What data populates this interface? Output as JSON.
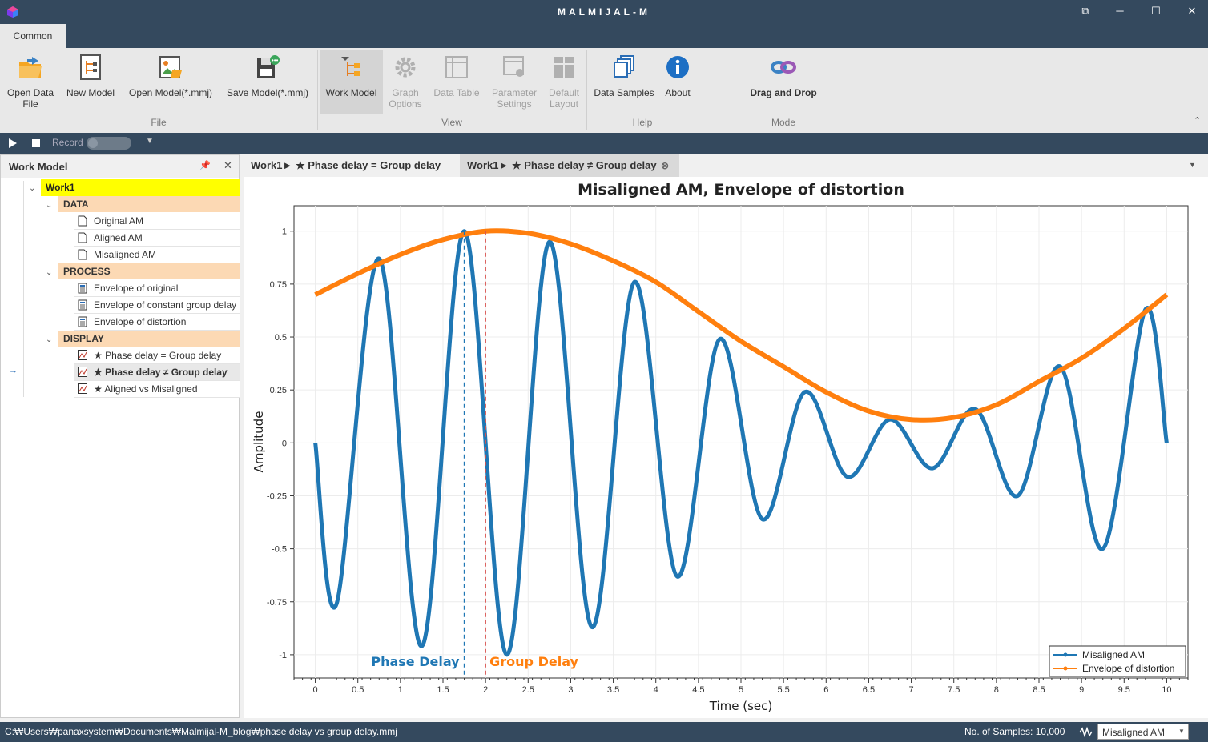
{
  "app": {
    "title": "MALMIJAL-M"
  },
  "ribbon": {
    "tab": "Common",
    "buttons": {
      "open_data_line1": "Open Data",
      "open_data_line2": "File",
      "new_model": "New Model",
      "open_model": "Open Model(*.mmj)",
      "save_model": "Save Model(*.mmj)",
      "work_model": "Work Model",
      "graph_options_line1": "Graph",
      "graph_options_line2": "Options",
      "data_table": "Data Table",
      "param_settings_line1": "Parameter",
      "param_settings_line2": "Settings",
      "default_layout_line1": "Default",
      "default_layout_line2": "Layout",
      "data_samples": "Data Samples",
      "about": "About",
      "drag_drop": "Drag and Drop"
    },
    "groups": {
      "file": "File",
      "view": "View",
      "help": "Help",
      "mode": "Mode"
    }
  },
  "record_bar": {
    "record_label": "Record"
  },
  "work_model_panel": {
    "title": "Work Model",
    "root": "Work1",
    "categories": [
      {
        "name": "DATA",
        "items": [
          "Original AM",
          "Aligned AM",
          "Misaligned AM"
        ]
      },
      {
        "name": "PROCESS",
        "items": [
          "Envelope of original",
          "Envelope of constant group delay",
          "Envelope of distortion"
        ]
      },
      {
        "name": "DISPLAY",
        "items": [
          "★ Phase delay = Group delay",
          "★ Phase delay ≠ Group delay",
          "★ Aligned vs Misaligned"
        ]
      }
    ],
    "selected_item": "★ Phase delay ≠ Group delay"
  },
  "doc_tabs": [
    {
      "label": "Work1► ★ Phase delay = Group delay",
      "active": false
    },
    {
      "label": "Work1► ★ Phase delay ≠ Group delay",
      "active": true
    }
  ],
  "chart_data": {
    "type": "line",
    "title": "Misaligned AM, Envelope of distortion",
    "xlabel": "Time (sec)",
    "ylabel": "Amplitude",
    "xlim": [
      -0.25,
      10.25
    ],
    "ylim": [
      -1.11,
      1.12
    ],
    "xticks": [
      0,
      0.5,
      1,
      1.5,
      2,
      2.5,
      3,
      3.5,
      4,
      4.5,
      5,
      5.5,
      6,
      6.5,
      7,
      7.5,
      8,
      8.5,
      9,
      9.5,
      10
    ],
    "yticks": [
      1,
      0.75,
      0.5,
      0.25,
      0,
      -0.25,
      -0.5,
      -0.75,
      -1
    ],
    "ytick_labels": [
      "1",
      "0.75",
      "0.5",
      "0.25",
      "0",
      "-0.25",
      "-0.5",
      "-0.75",
      "-1"
    ],
    "legend_position": "bottom-right",
    "grid": true,
    "series": [
      {
        "name": "Misaligned AM",
        "color": "#1f77b4",
        "x": [
          0,
          0.25,
          0.75,
          1.25,
          1.75,
          2.25,
          2.75,
          3.25,
          3.75,
          4.25,
          4.75,
          5.25,
          5.75,
          6.25,
          6.75,
          7.25,
          7.75,
          8.25,
          8.75,
          9.25,
          9.75,
          10
        ],
        "y": [
          0,
          -0.76,
          0.87,
          -0.96,
          1.0,
          -1.0,
          0.95,
          -0.87,
          0.76,
          -0.63,
          0.49,
          -0.36,
          0.24,
          -0.16,
          0.11,
          -0.12,
          0.16,
          -0.25,
          0.36,
          -0.5,
          0.63,
          0
        ]
      },
      {
        "name": "Envelope of distortion",
        "color": "#ff7f0e",
        "x": [
          0,
          0.5,
          1,
          1.5,
          2,
          2.5,
          3,
          3.5,
          4,
          4.5,
          5,
          5.5,
          6,
          6.5,
          7,
          7.5,
          8,
          8.5,
          9,
          9.5,
          10
        ],
        "y": [
          0.7,
          0.8,
          0.89,
          0.96,
          1.0,
          0.99,
          0.94,
          0.86,
          0.76,
          0.62,
          0.48,
          0.36,
          0.24,
          0.15,
          0.11,
          0.12,
          0.18,
          0.29,
          0.4,
          0.54,
          0.7
        ]
      }
    ],
    "annotations": [
      {
        "text": "Phase Delay",
        "x": 1.75,
        "color": "#1f77b4"
      },
      {
        "text": "Group Delay",
        "x": 2.0,
        "color": "#ff7f0e"
      }
    ]
  },
  "status_bar": {
    "path": "C:₩Users₩panaxsystem₩Documents₩Malmijal-M_blog₩phase delay vs group delay.mmj",
    "samples": "No. of Samples: 10,000",
    "selected_series": "Misaligned AM"
  }
}
